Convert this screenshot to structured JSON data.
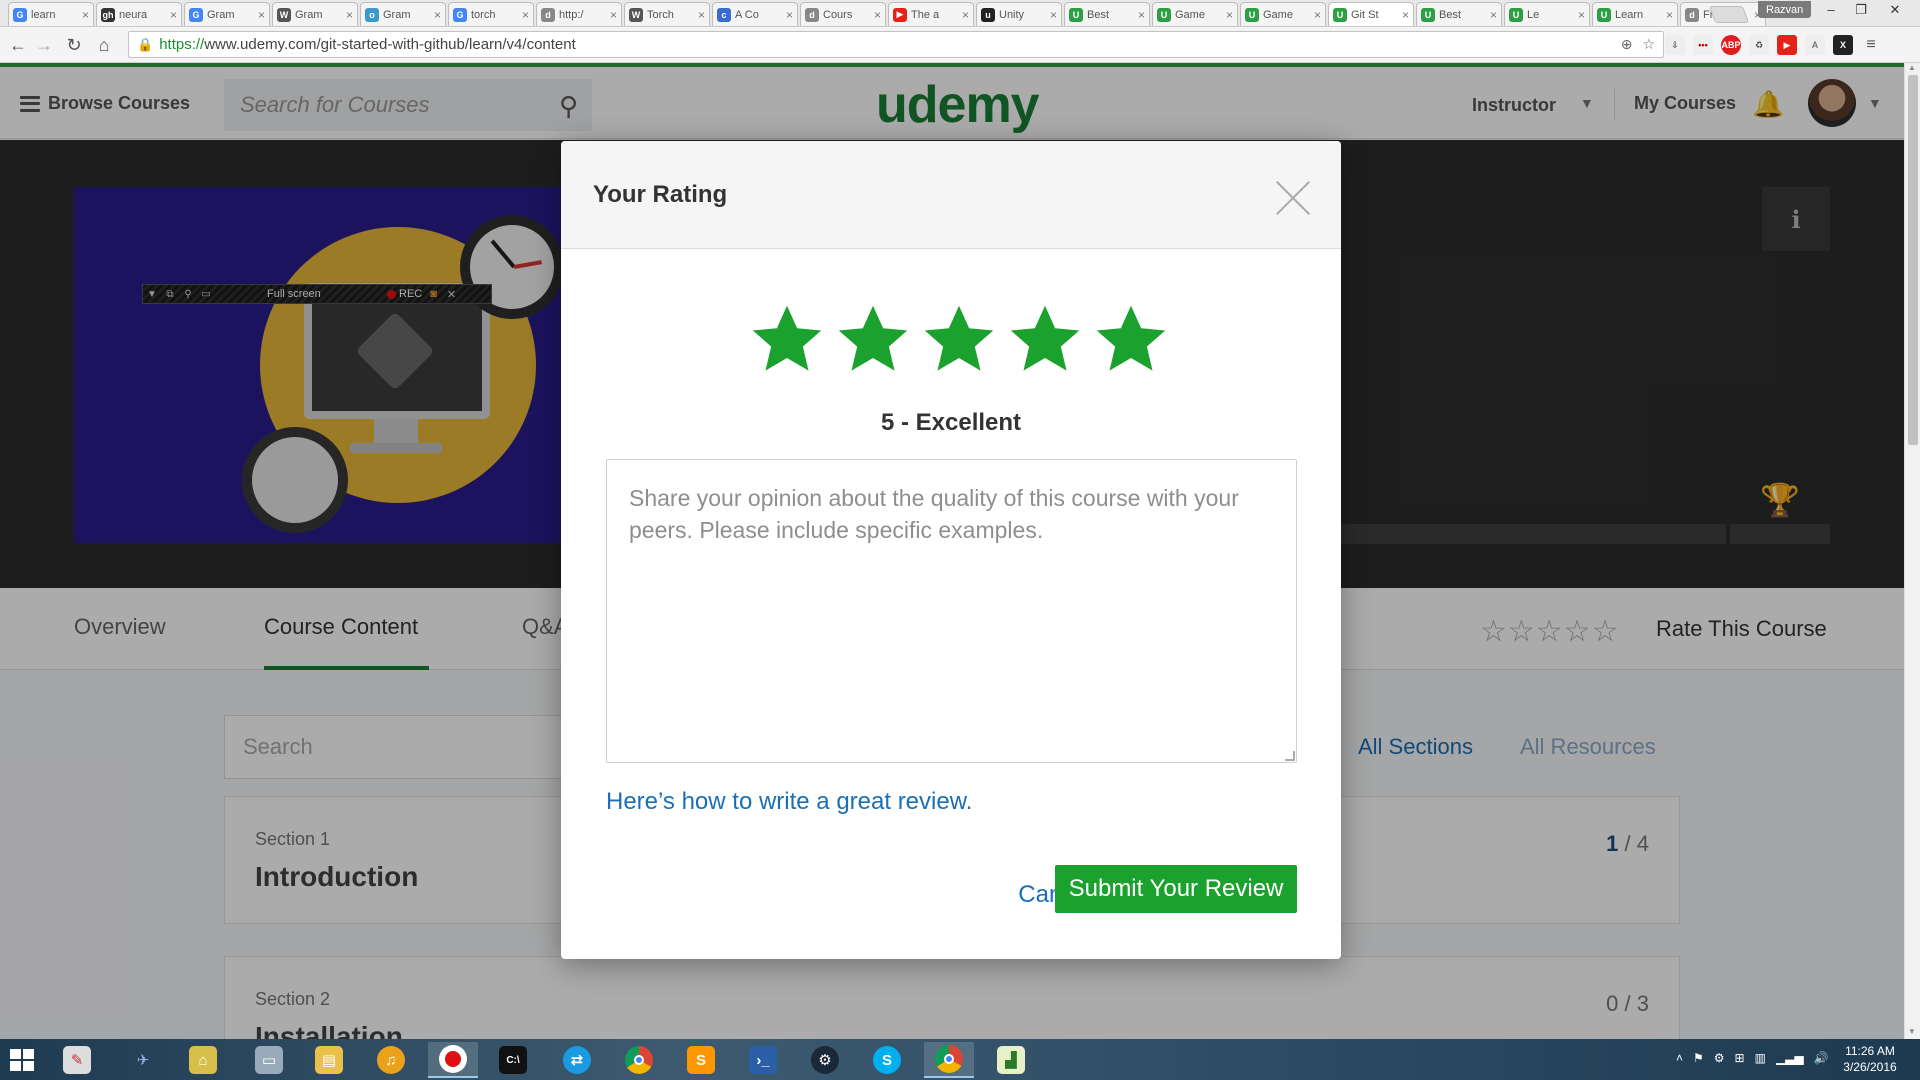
{
  "browser": {
    "tabs": [
      {
        "label": "learn",
        "fav": "G",
        "color": "#4285f4"
      },
      {
        "label": "neura",
        "fav": "gh",
        "color": "#333333"
      },
      {
        "label": "Gram",
        "fav": "G",
        "color": "#4285f4"
      },
      {
        "label": "Gram",
        "fav": "W",
        "color": "#555555"
      },
      {
        "label": "Gram",
        "fav": "o",
        "color": "#3b9ac9"
      },
      {
        "label": "torch",
        "fav": "G",
        "color": "#4285f4"
      },
      {
        "label": "http:/",
        "fav": "d",
        "color": "#888888"
      },
      {
        "label": "Torch",
        "fav": "W",
        "color": "#555555"
      },
      {
        "label": "A Co",
        "fav": "c",
        "color": "#3a6bd1"
      },
      {
        "label": "Cours",
        "fav": "d",
        "color": "#888888"
      },
      {
        "label": "The a",
        "fav": "▶",
        "color": "#e62117"
      },
      {
        "label": "Unity",
        "fav": "u",
        "color": "#222222"
      },
      {
        "label": "Best",
        "fav": "U",
        "color": "#2ea043"
      },
      {
        "label": "Game",
        "fav": "U",
        "color": "#2ea043"
      },
      {
        "label": "Game",
        "fav": "U",
        "color": "#2ea043"
      },
      {
        "label": "Git St",
        "fav": "U",
        "color": "#2ea043"
      },
      {
        "label": "Best",
        "fav": "U",
        "color": "#2ea043"
      },
      {
        "label": "Le",
        "fav": "U",
        "color": "#2ea043"
      },
      {
        "label": "Learn",
        "fav": "U",
        "color": "#2ea043"
      },
      {
        "label": "Free",
        "fav": "d",
        "color": "#888888"
      }
    ],
    "active_tab": 15,
    "profile": "Razvan",
    "url_scheme": "https://",
    "url_rest": "www.udemy.com/git-started-with-github/learn/v4/content"
  },
  "header": {
    "browse": "Browse Courses",
    "search_placeholder": "Search for Courses",
    "logo": "udemy",
    "instructor": "Instructor",
    "my_courses": "My Courses"
  },
  "recorder": {
    "label": "Full screen",
    "rec": "REC"
  },
  "course_tabs": {
    "overview": "Overview",
    "content": "Course Content",
    "qa": "Q&A",
    "rate_label": "Rate This Course"
  },
  "content": {
    "search_placeholder": "Search",
    "all_sections": "All Sections",
    "all_resources": "All Resources",
    "sections": [
      {
        "num": "Section 1",
        "title": "Introduction",
        "done": "1",
        "total": "/ 4"
      },
      {
        "num": "Section 2",
        "title": "Installation",
        "done": "0",
        "total": "/ 3"
      }
    ]
  },
  "modal": {
    "title": "Your Rating",
    "rating_value": 5,
    "star_color": "#1aa12e",
    "rating_text": "5 - Excellent",
    "review_placeholder": "Share your opinion about the quality of this course with your peers. Please include specific examples.",
    "guide_link": "Here’s how to write a great review.",
    "cancel": "Cancel",
    "submit": "Submit Your Review"
  },
  "taskbar": {
    "time": "11:26 AM",
    "date": "3/26/2016"
  }
}
